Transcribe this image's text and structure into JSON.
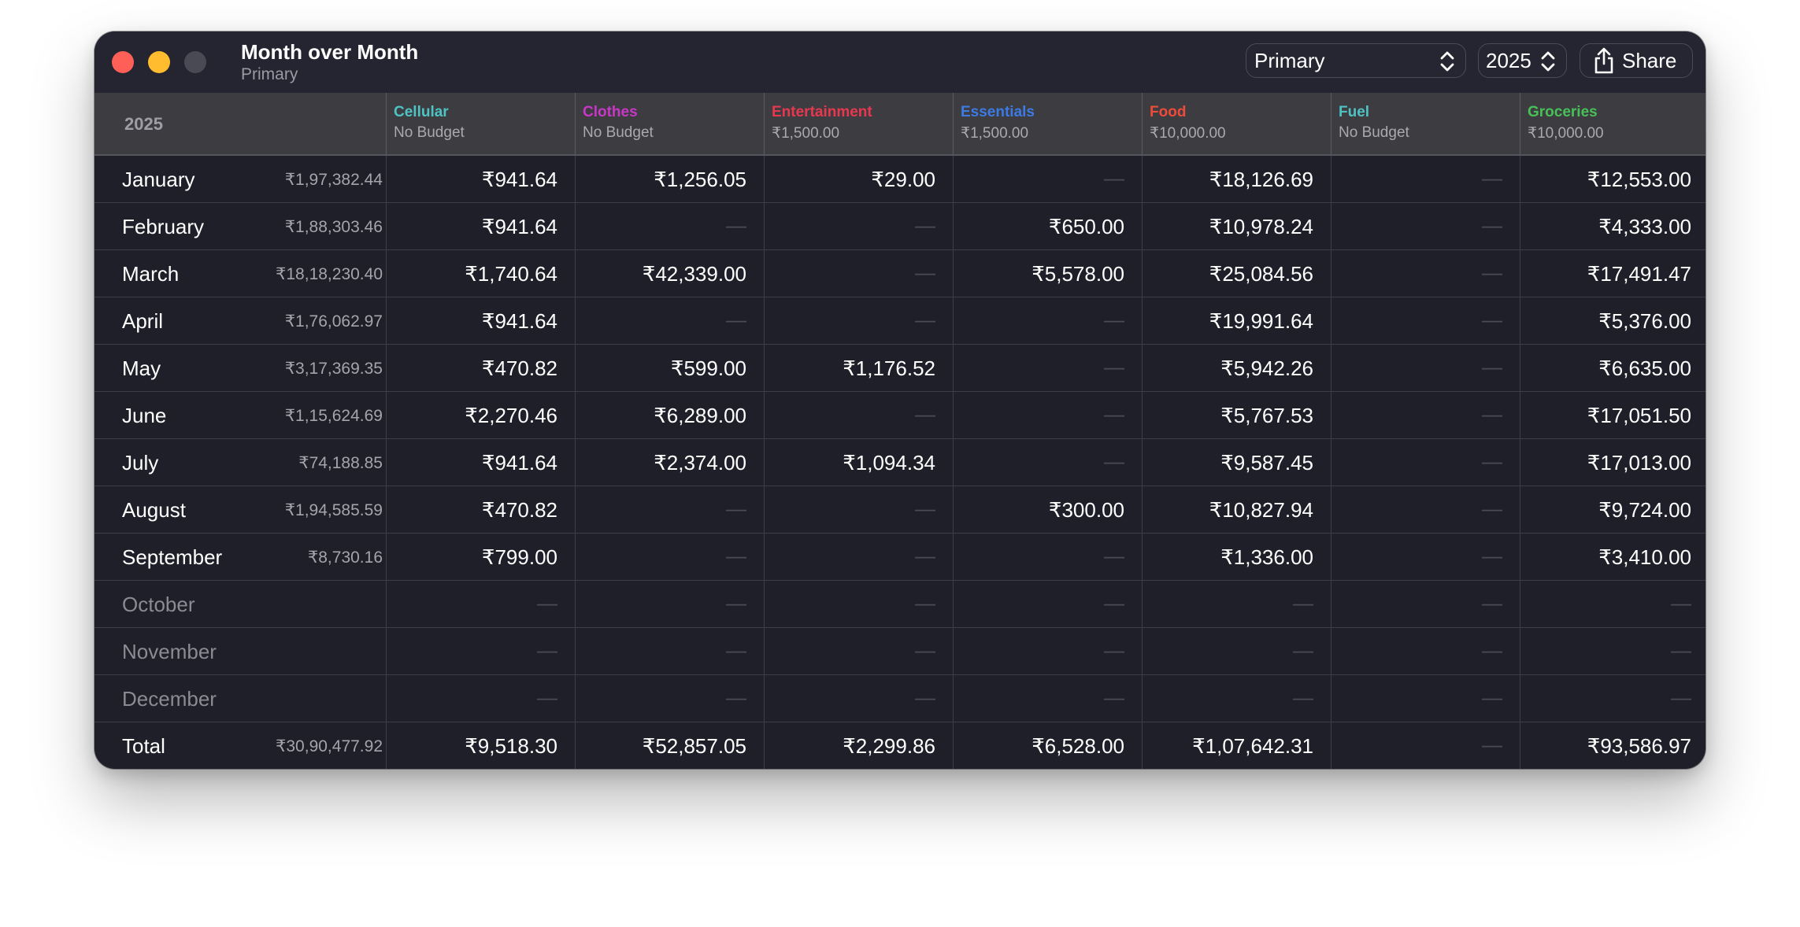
{
  "window": {
    "title": "Month over Month",
    "subtitle": "Primary"
  },
  "toolbar": {
    "account_select": "Primary",
    "year_select": "2025",
    "share_label": "Share"
  },
  "table": {
    "year_label": "2025",
    "columns": [
      {
        "name": "Cellular",
        "budget": "No Budget",
        "color": "#4fc3c3"
      },
      {
        "name": "Clothes",
        "budget": "No Budget",
        "color": "#c837c8"
      },
      {
        "name": "Entertainment",
        "budget": "₹1,500.00",
        "color": "#e8384f"
      },
      {
        "name": "Essentials",
        "budget": "₹1,500.00",
        "color": "#3d7ae3"
      },
      {
        "name": "Food",
        "budget": "₹10,000.00",
        "color": "#ee4b3a"
      },
      {
        "name": "Fuel",
        "budget": "No Budget",
        "color": "#4fc3c3"
      },
      {
        "name": "Groceries",
        "budget": "₹10,000.00",
        "color": "#48c058"
      }
    ],
    "rows": [
      {
        "month": "January",
        "total": "₹1,97,382.44",
        "values": [
          "₹941.64",
          "₹1,256.05",
          "₹29.00",
          "—",
          "₹18,126.69",
          "—",
          "₹12,553.00"
        ],
        "dim": false
      },
      {
        "month": "February",
        "total": "₹1,88,303.46",
        "values": [
          "₹941.64",
          "—",
          "—",
          "₹650.00",
          "₹10,978.24",
          "—",
          "₹4,333.00"
        ],
        "dim": false
      },
      {
        "month": "March",
        "total": "₹18,18,230.40",
        "values": [
          "₹1,740.64",
          "₹42,339.00",
          "—",
          "₹5,578.00",
          "₹25,084.56",
          "—",
          "₹17,491.47"
        ],
        "dim": false
      },
      {
        "month": "April",
        "total": "₹1,76,062.97",
        "values": [
          "₹941.64",
          "—",
          "—",
          "—",
          "₹19,991.64",
          "—",
          "₹5,376.00"
        ],
        "dim": false
      },
      {
        "month": "May",
        "total": "₹3,17,369.35",
        "values": [
          "₹470.82",
          "₹599.00",
          "₹1,176.52",
          "—",
          "₹5,942.26",
          "—",
          "₹6,635.00"
        ],
        "dim": false
      },
      {
        "month": "June",
        "total": "₹1,15,624.69",
        "values": [
          "₹2,270.46",
          "₹6,289.00",
          "—",
          "—",
          "₹5,767.53",
          "—",
          "₹17,051.50"
        ],
        "dim": false
      },
      {
        "month": "July",
        "total": "₹74,188.85",
        "values": [
          "₹941.64",
          "₹2,374.00",
          "₹1,094.34",
          "—",
          "₹9,587.45",
          "—",
          "₹17,013.00"
        ],
        "dim": false
      },
      {
        "month": "August",
        "total": "₹1,94,585.59",
        "values": [
          "₹470.82",
          "—",
          "—",
          "₹300.00",
          "₹10,827.94",
          "—",
          "₹9,724.00"
        ],
        "dim": false
      },
      {
        "month": "September",
        "total": "₹8,730.16",
        "values": [
          "₹799.00",
          "—",
          "—",
          "—",
          "₹1,336.00",
          "—",
          "₹3,410.00"
        ],
        "dim": false
      },
      {
        "month": "October",
        "total": "",
        "values": [
          "—",
          "—",
          "—",
          "—",
          "—",
          "—",
          "—"
        ],
        "dim": true
      },
      {
        "month": "November",
        "total": "",
        "values": [
          "—",
          "—",
          "—",
          "—",
          "—",
          "—",
          "—"
        ],
        "dim": true
      },
      {
        "month": "December",
        "total": "",
        "values": [
          "—",
          "—",
          "—",
          "—",
          "—",
          "—",
          "—"
        ],
        "dim": true
      },
      {
        "month": "Total",
        "total": "₹30,90,477.92",
        "values": [
          "₹9,518.30",
          "₹52,857.05",
          "₹2,299.86",
          "₹6,528.00",
          "₹1,07,642.31",
          "—",
          "₹93,586.97"
        ],
        "dim": false
      }
    ]
  }
}
